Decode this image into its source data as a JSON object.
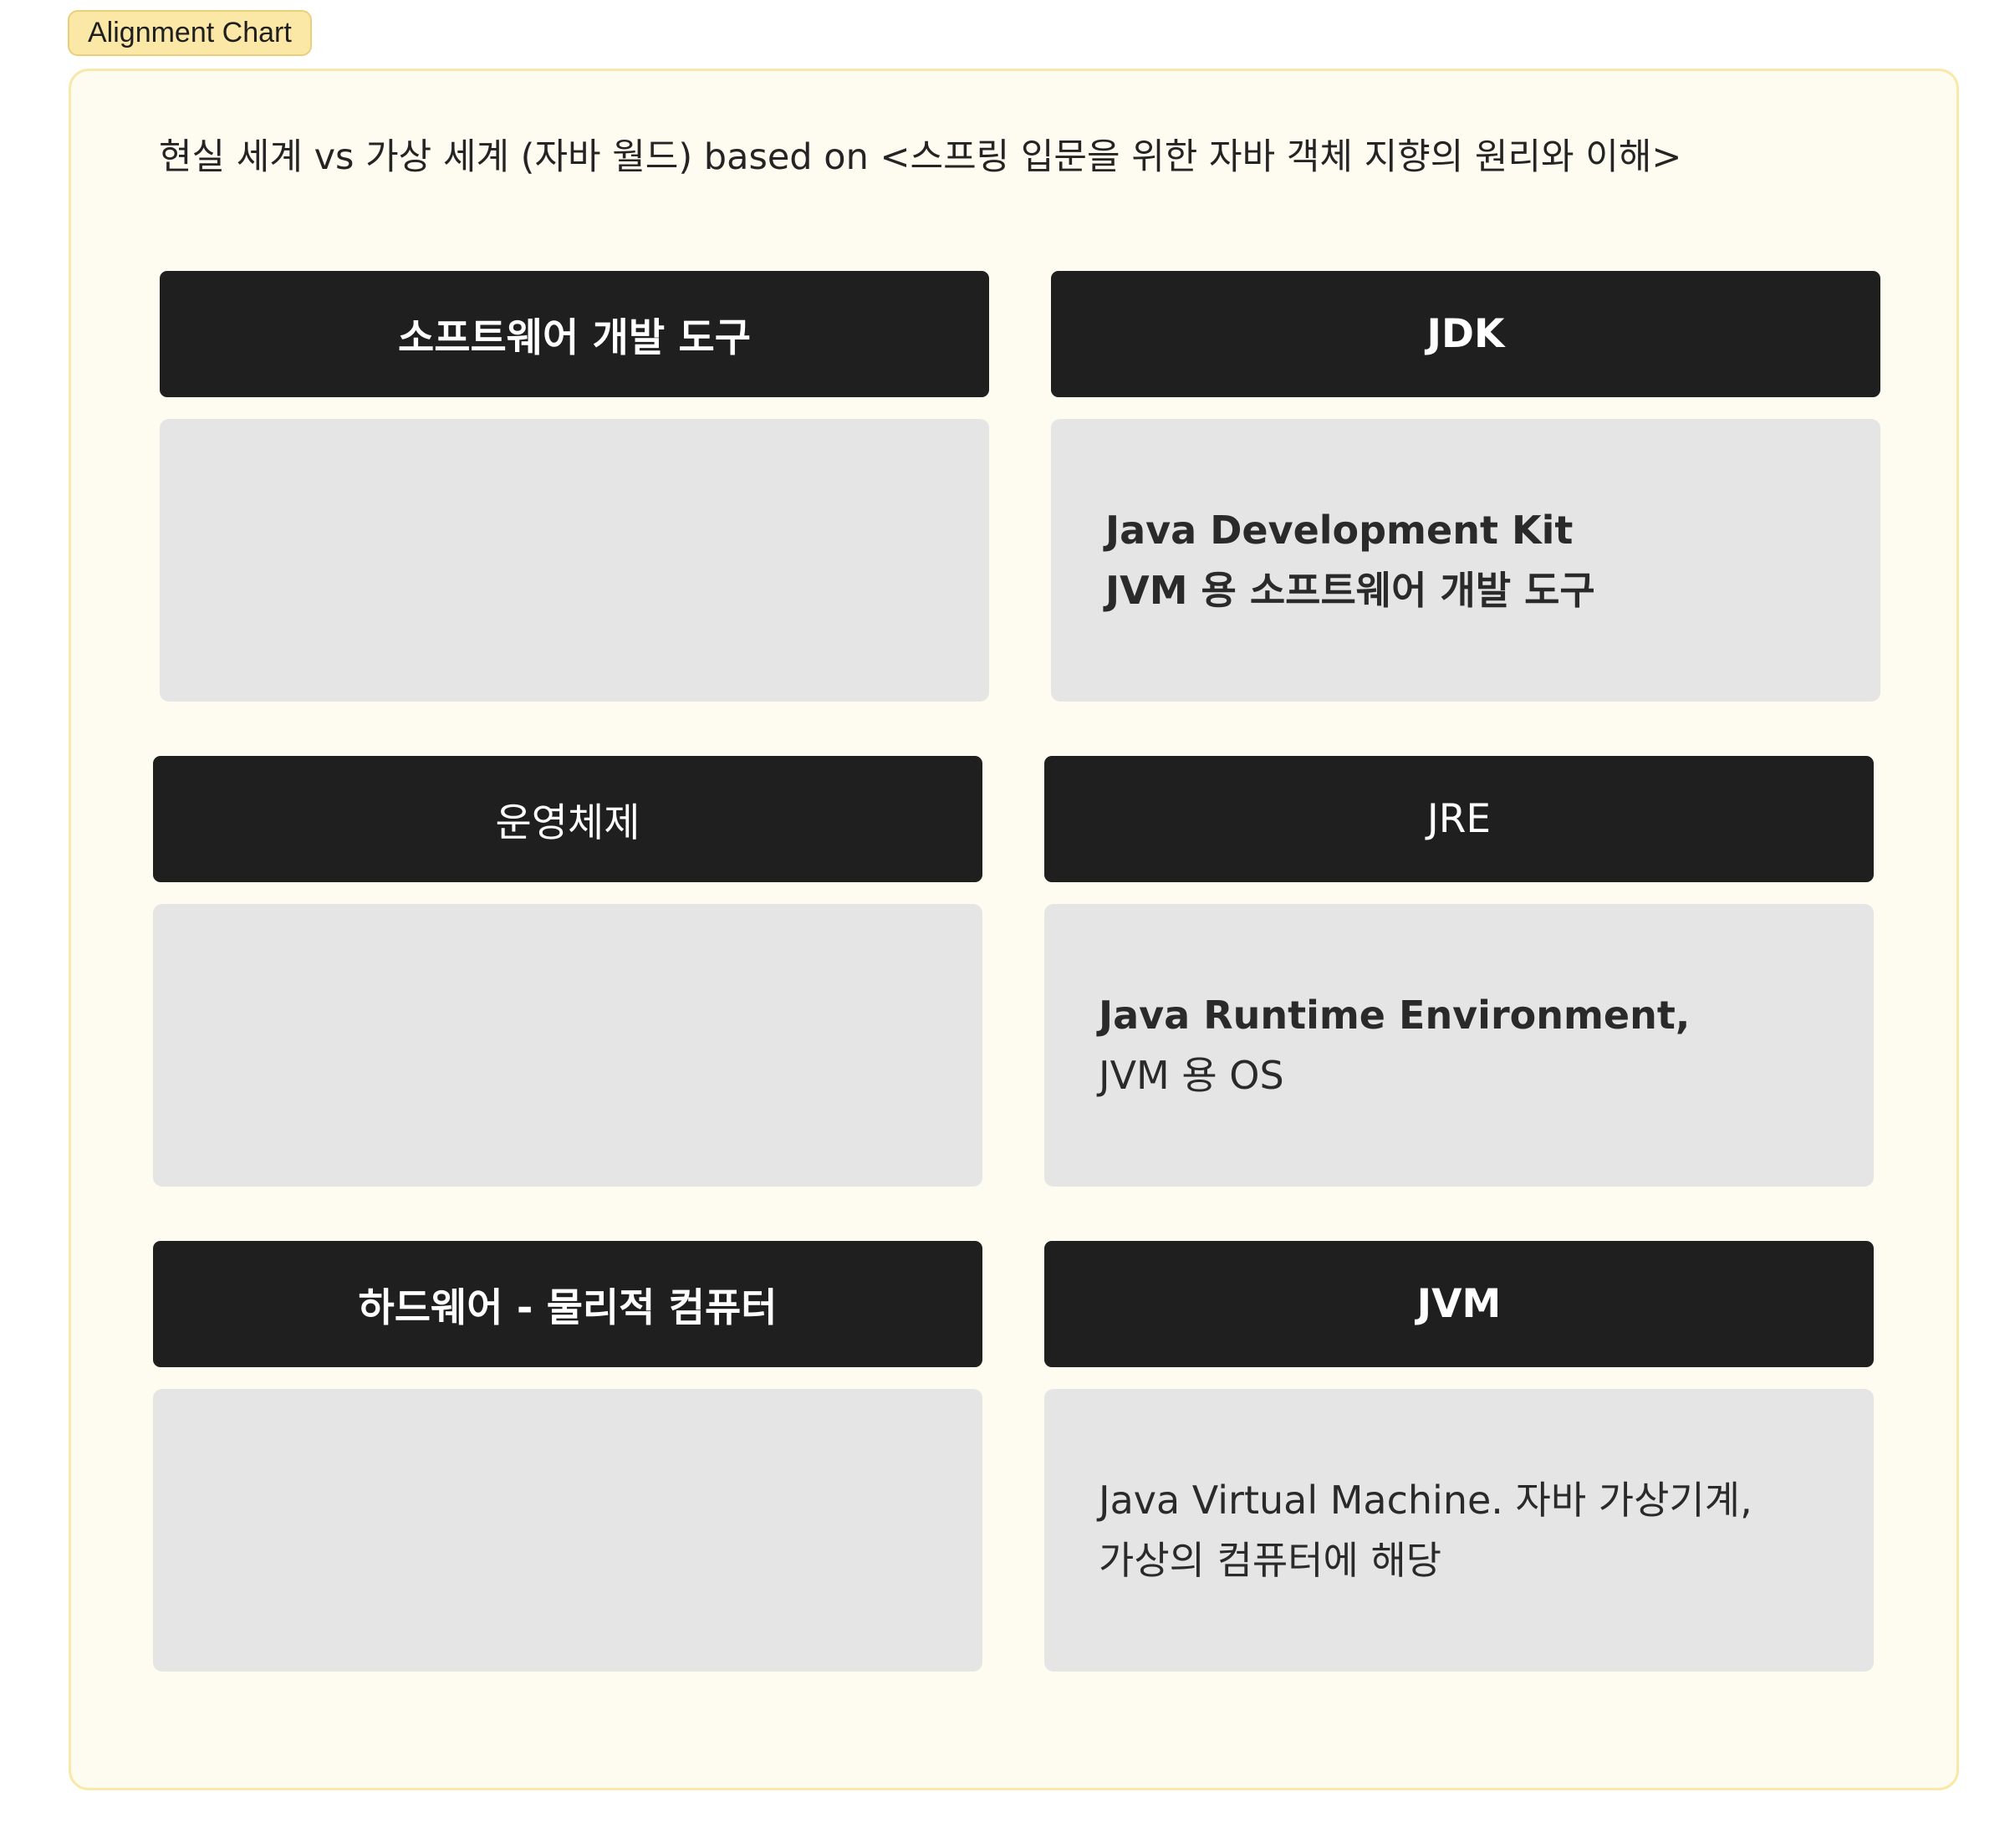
{
  "tag": {
    "label": "Alignment Chart"
  },
  "frame": {
    "title": "현실 세계 vs 가상 세계 (자바 월드) based on <스프링 입문을 위한 자바 객체 지향의 원리와 이해>"
  },
  "rows": [
    {
      "left": {
        "header": "소프트웨어 개발 도구",
        "lines": []
      },
      "right": {
        "header": "JDK",
        "lines": [
          "Java Development Kit",
          "JVM 용 소프트웨어 개발 도구"
        ]
      }
    },
    {
      "left": {
        "header": "운영체제",
        "lines": []
      },
      "right": {
        "header": "JRE",
        "lines": [
          "Java Runtime Environment,",
          "JVM 용 OS"
        ]
      }
    },
    {
      "left": {
        "header": "하드웨어 - 물리적 컴퓨터",
        "lines": []
      },
      "right": {
        "header": "JVM",
        "lines": [
          "Java Virtual Machine. 자바 가상기계,",
          "가상의 컴퓨터에 해당"
        ]
      }
    }
  ]
}
